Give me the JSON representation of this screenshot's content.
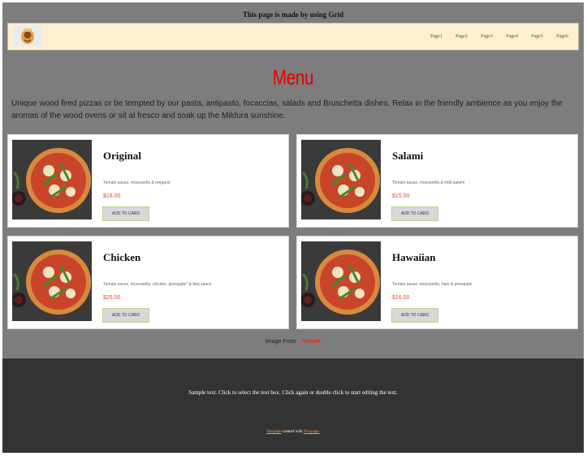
{
  "header": {
    "note": "This page is made by using Grid"
  },
  "nav": {
    "logo_icon": "pizza-chef-logo",
    "items": [
      "Page1",
      "Page2",
      "Page3",
      "Page4",
      "Page5",
      "Page6"
    ]
  },
  "menu": {
    "title": "Menu",
    "intro": "Unique wood fired pizzas or be tempted by our pasta, antipasto, focaccias, salads and Bruschetta dishes. Relax in the friendly ambience as you enjoy the aromas of the wood ovens or sit al fresco and soak up the Mildura sunshine."
  },
  "cards": [
    {
      "name": "Original",
      "desc": "Tomato sauce, mozzarella & oregano",
      "price": "$18.00",
      "button": "ADD TO CARD"
    },
    {
      "name": "Salami",
      "desc": "Tomato sauce, mozzarella & mild salami",
      "price": "$15.00",
      "button": "ADD TO CARD"
    },
    {
      "name": "Chicken",
      "desc": "Tomato sauce, mozzarella, chicken, pineapple* & bbq sauce",
      "price": "$25.00",
      "button": "ADD TO CARD"
    },
    {
      "name": "Hawaiian",
      "desc": "Tomato sauce, mozzarella, ham & pineapple",
      "price": "$16.00",
      "button": "ADD TO CARD"
    }
  ],
  "credit": {
    "label": "Image From",
    "source": "Freepik"
  },
  "footer": {
    "text": "Sample text. Click to select the text box. Click again or double click to start editing the text.",
    "template_link": "Template",
    "created_with": "created with",
    "nicepage_link": "Nicepage."
  },
  "colors": {
    "accent": "#e60000",
    "price": "#e34a2e",
    "footer_bg": "#333333",
    "page_bg": "#7d7d7d",
    "nav_bg": "#fdefd0"
  }
}
